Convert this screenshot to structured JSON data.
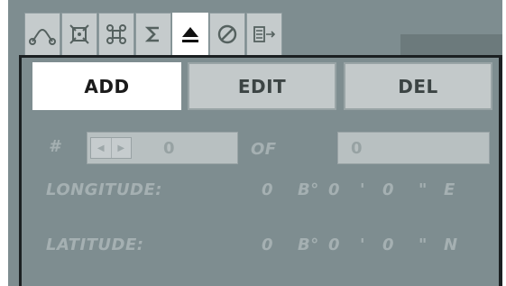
{
  "tabs": [
    {
      "icon": "curve-icon",
      "active": false
    },
    {
      "icon": "crosshair-box-icon",
      "active": false
    },
    {
      "icon": "command-icon",
      "active": false
    },
    {
      "icon": "sigma-icon",
      "active": false
    },
    {
      "icon": "eject-icon",
      "active": true
    },
    {
      "icon": "no-entry-icon",
      "active": false
    },
    {
      "icon": "list-transfer-icon",
      "active": false
    }
  ],
  "actions": {
    "add": "ADD",
    "edit": "EDIT",
    "del": "DEL",
    "selected": "ADD"
  },
  "counter": {
    "hash_label": "#",
    "current": "0",
    "of_label": "OF",
    "total": "0"
  },
  "longitude": {
    "label": "LONGITUDE:",
    "deg": "0",
    "deg_symbol": "B°",
    "min": "0",
    "min_symbol": "'",
    "sec": "0",
    "sec_symbol": "\"",
    "hemisphere": "E"
  },
  "latitude": {
    "label": "LATITUDE:",
    "deg": "0",
    "deg_symbol": "B°",
    "min": "0",
    "min_symbol": "'",
    "sec": "0",
    "sec_symbol": "\"",
    "hemisphere": "N"
  },
  "colors": {
    "panel": "#7e8d90",
    "tab": "#c5cbcc",
    "active": "#ffffff",
    "label": "#a5b0b2"
  }
}
